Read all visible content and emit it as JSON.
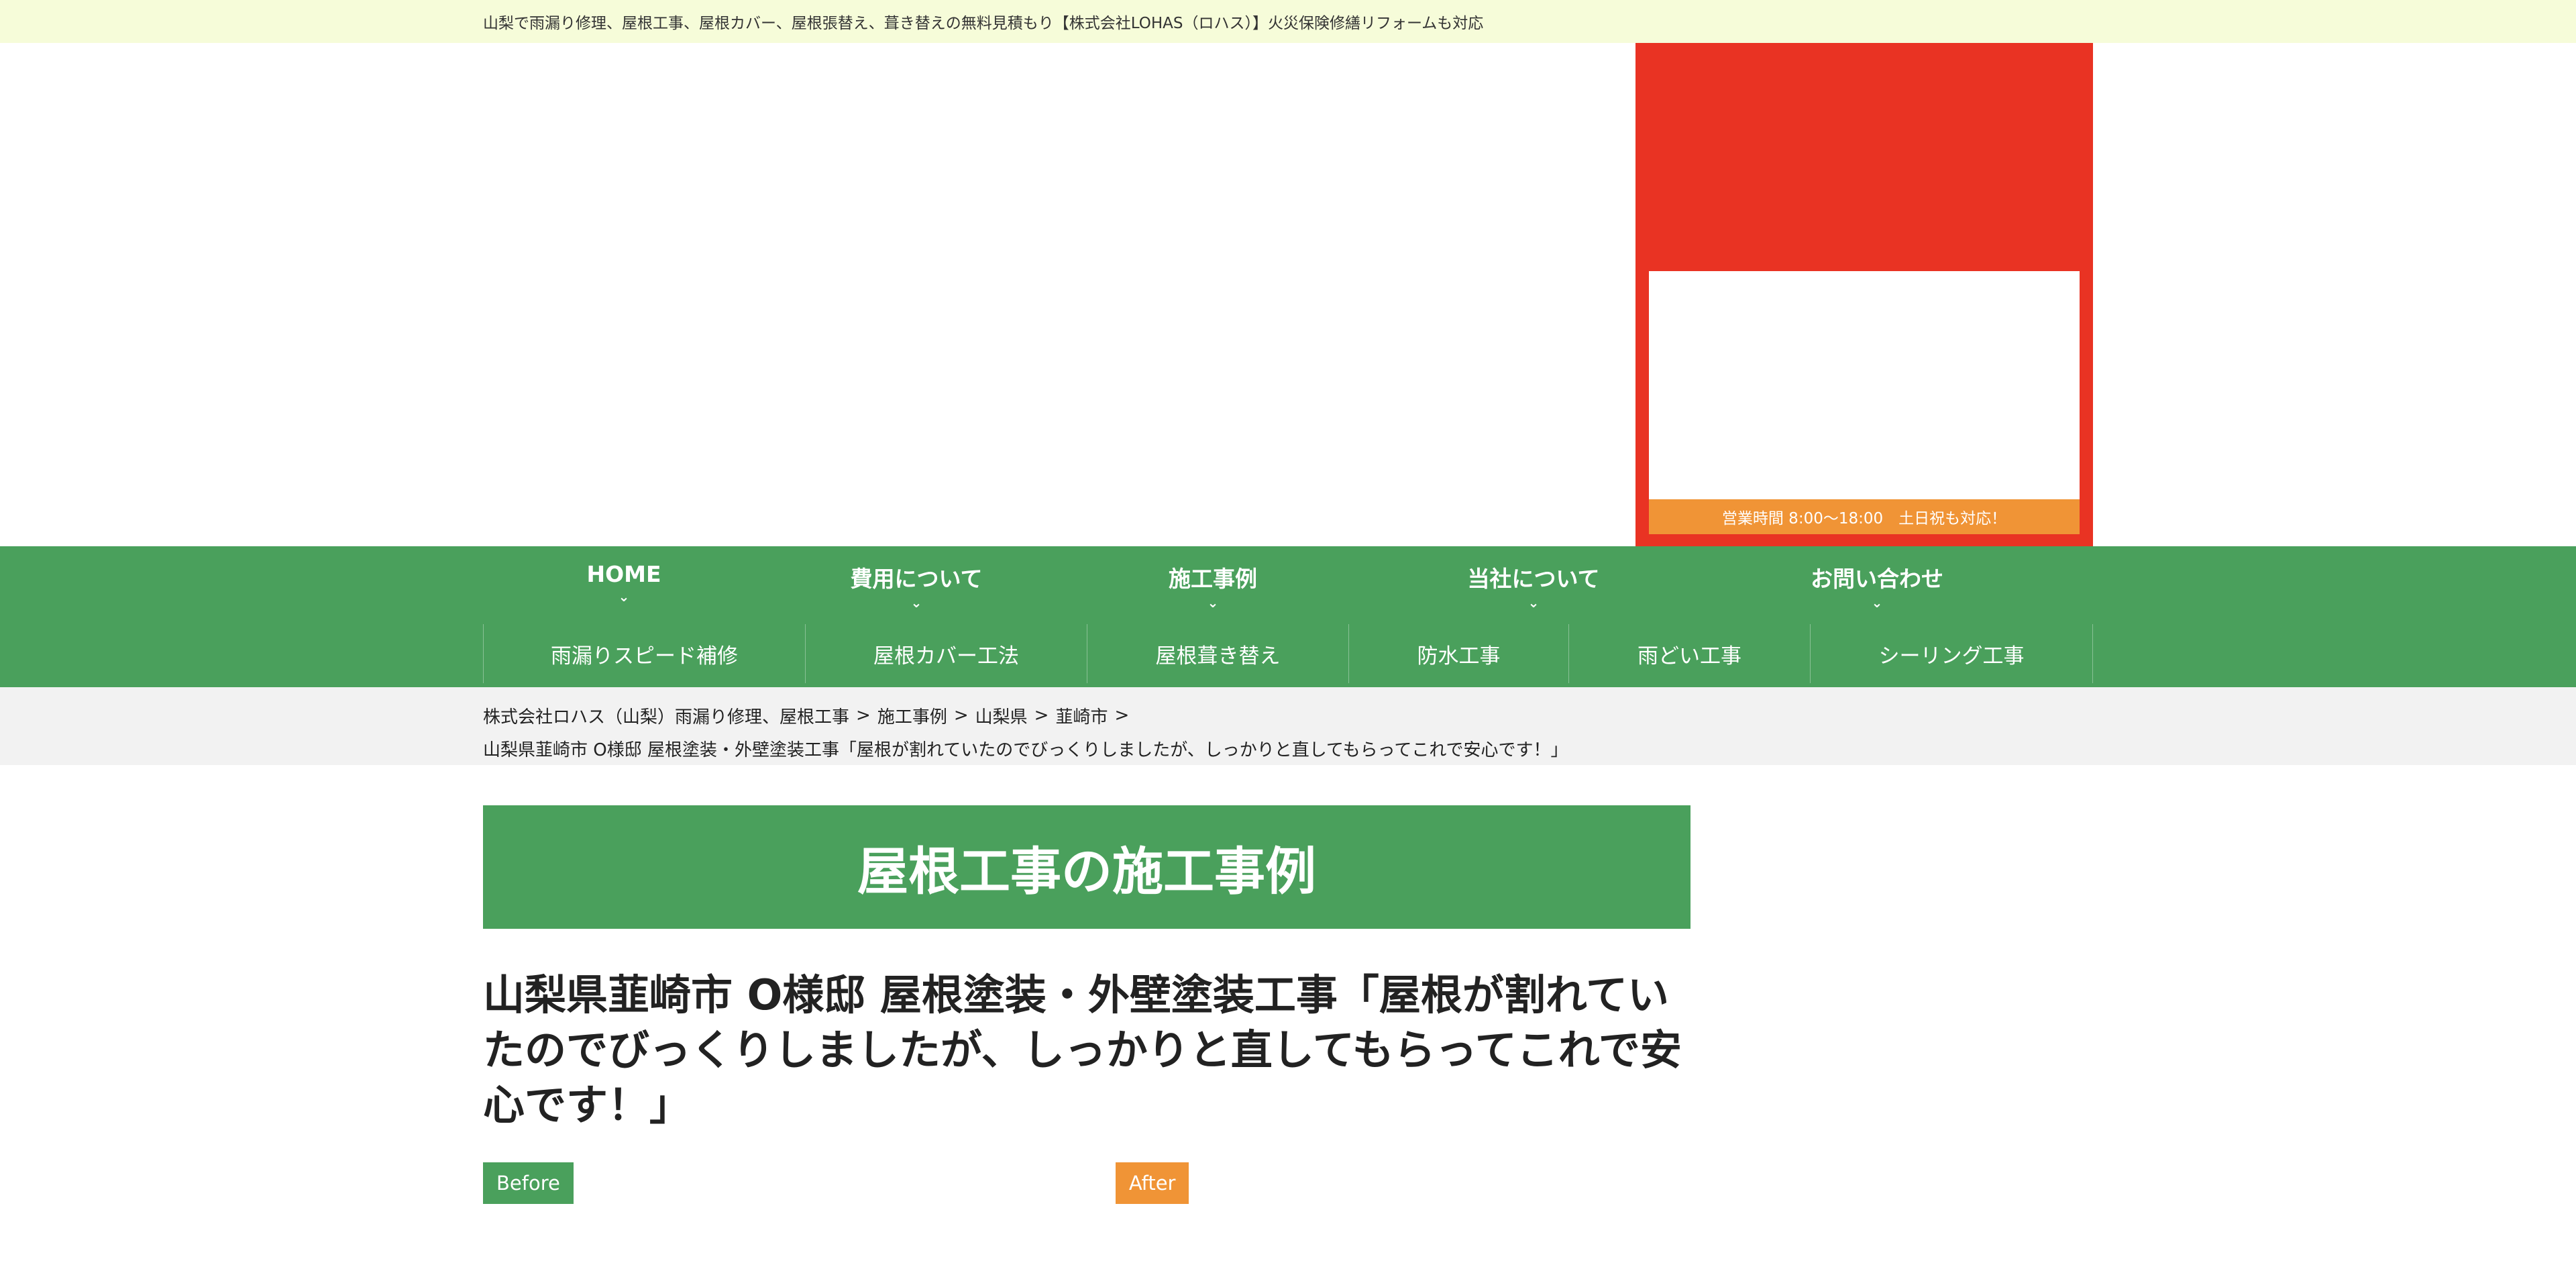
{
  "topbar": {
    "text": "山梨で雨漏り修理、屋根工事、屋根カバー、屋根張替え、葺き替えの無料見積もり【株式会社LOHAS（ロハス）】火災保険修繕リフォームも対応"
  },
  "header": {
    "hours": "営業時間 8:00〜18:00　土日祝も対応！"
  },
  "nav": {
    "main": [
      {
        "label": "HOME"
      },
      {
        "label": "費用について"
      },
      {
        "label": "施工事例"
      },
      {
        "label": "当社について"
      },
      {
        "label": "お問い合わせ"
      }
    ],
    "sub": [
      {
        "label": "雨漏りスピード補修"
      },
      {
        "label": "屋根カバー工法"
      },
      {
        "label": "屋根葺き替え"
      },
      {
        "label": "防水工事"
      },
      {
        "label": "雨どい工事"
      },
      {
        "label": "シーリング工事"
      }
    ],
    "chevron": "⌄"
  },
  "breadcrumb": {
    "items": [
      "株式会社ロハス（山梨）雨漏り修理、屋根工事",
      "施工事例",
      "山梨県",
      "韮崎市"
    ],
    "separator": ">",
    "current": "山梨県韮崎市 O様邸 屋根塗装・外壁塗装工事「屋根が割れていたのでびっくりしましたが、しっかりと直してもらってこれで安心です！」"
  },
  "main": {
    "section_heading": "屋根工事の施工事例",
    "post_title": "山梨県韮崎市 O様邸 屋根塗装・外壁塗装工事「屋根が割れていたのでびっくりしましたが、しっかりと直してもらってこれで安心です！」",
    "before_label": "Before",
    "after_label": "After"
  },
  "colors": {
    "green": "#4aa05c",
    "orange": "#f09436",
    "red": "#e93323",
    "topbar_bg": "#f6fcd9",
    "breadcrumb_bg": "#f2f2f2"
  }
}
